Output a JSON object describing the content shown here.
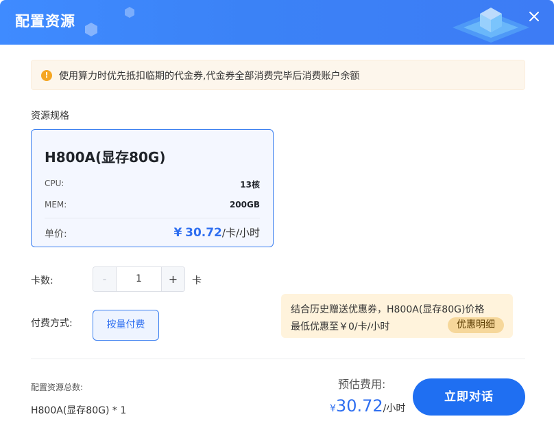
{
  "header": {
    "title": "配置资源"
  },
  "notice": {
    "text": "使用算力时优先抵扣临期的代金券,代金券全部消费完毕后消费账户余额"
  },
  "spec_section": {
    "label": "资源规格"
  },
  "spec_card": {
    "name": "H800A(显存80G)",
    "cpu_label": "CPU:",
    "cpu_value": "13核",
    "mem_label": "MEM:",
    "mem_value": "200GB",
    "price_label": "单价:",
    "price_currency": "¥",
    "price_value": "30.72",
    "price_unit": "/卡/小时"
  },
  "card_count": {
    "label": "卡数:",
    "minus": "-",
    "value": "1",
    "plus": "+",
    "unit": "卡"
  },
  "payment": {
    "label": "付费方式:",
    "option": "按量付费"
  },
  "promo": {
    "line1": "结合历史赠送优惠券，H800A(显存80G)价格",
    "line2": "最低优惠至￥0/卡/小时",
    "link": "优惠明细"
  },
  "summary": {
    "total_label": "配置资源总数:",
    "total_value": "H800A(显存80G) * 1",
    "estimate_label": "预估费用:",
    "estimate_currency": "¥",
    "estimate_value": "30.72",
    "estimate_unit": "/小时"
  },
  "actions": {
    "cta": "立即对话"
  },
  "colors": {
    "accent": "#1f6ff2",
    "header_bg": "#3b82f6",
    "notice_bg": "#fdf6ec",
    "promo_bg": "#fff3dc"
  },
  "icons": {
    "close": "close-icon",
    "warning": "warning-icon"
  }
}
